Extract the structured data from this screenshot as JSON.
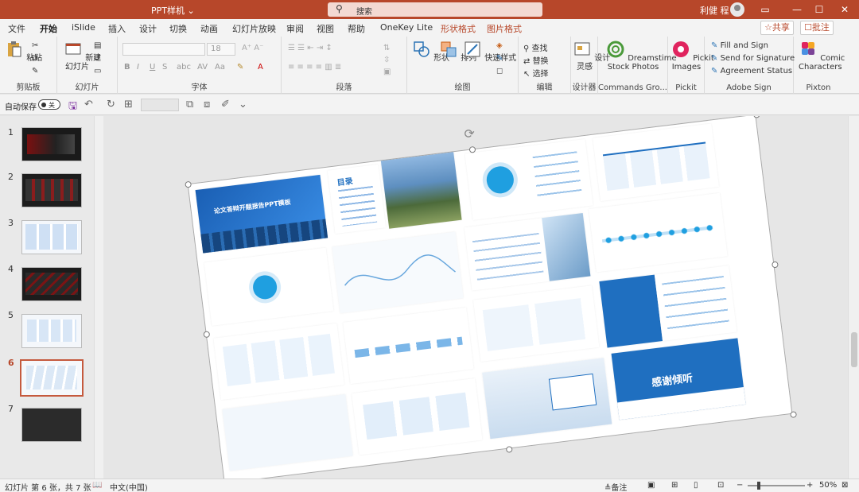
{
  "titlebar": {
    "doc_title": "PPT样机 ⌄",
    "search_placeholder": "搜索",
    "user_name": "利健 程",
    "window_buttons": [
      "▭",
      "—",
      "☐",
      "✕"
    ]
  },
  "tabs": {
    "items": [
      {
        "label": "文件",
        "state": "normal"
      },
      {
        "label": "开始",
        "state": "active"
      },
      {
        "label": "iSlide",
        "state": "normal"
      },
      {
        "label": "插入",
        "state": "normal"
      },
      {
        "label": "设计",
        "state": "normal"
      },
      {
        "label": "切换",
        "state": "normal"
      },
      {
        "label": "动画",
        "state": "normal"
      },
      {
        "label": "幻灯片放映",
        "state": "normal"
      },
      {
        "label": "审阅",
        "state": "normal"
      },
      {
        "label": "视图",
        "state": "normal"
      },
      {
        "label": "帮助",
        "state": "normal"
      },
      {
        "label": "OneKey Lite",
        "state": "normal"
      },
      {
        "label": "形状格式",
        "state": "contextual"
      },
      {
        "label": "图片格式",
        "state": "contextual"
      }
    ],
    "share_label": "☆共享",
    "comments_label": "☐批注"
  },
  "ribbon": {
    "clipboard": {
      "paste_label": "粘贴",
      "group_label": "剪贴板"
    },
    "slides": {
      "new_slide_label": "新建\n幻灯片",
      "group_label": "幻灯片"
    },
    "font": {
      "size_value": "18",
      "bold": "B",
      "italic": "I",
      "underline": "U",
      "strike": "S",
      "group_label": "字体"
    },
    "paragraph": {
      "group_label": "段落"
    },
    "drawing": {
      "shape_label": "形状",
      "arrange_label": "排列",
      "quick_styles_label": "快速样式",
      "group_label": "绘图"
    },
    "editing": {
      "find_label": "查找",
      "replace_label": "替换",
      "select_label": "选择",
      "group_label": "编辑"
    },
    "designer": {
      "label": "设计\n灵感",
      "group_label": "设计器"
    },
    "dreamstime": {
      "label": "Dreamstime\nStock Photos",
      "group_label": "Commands Gro..."
    },
    "pickit": {
      "label": "Pickit\nImages",
      "group_label": "Pickit"
    },
    "adobe_sign": {
      "fill_sign": "Fill and Sign",
      "send_sign": "Send for Signature",
      "agreement": "Agreement Status",
      "group_label": "Adobe Sign"
    },
    "pixton": {
      "label": "Comic\nCharacters",
      "group_label": "Pixton"
    }
  },
  "qat": {
    "autosave_label": "自动保存",
    "toggle_label": "关"
  },
  "thumbnails": {
    "items": [
      {
        "num": "1"
      },
      {
        "num": "2"
      },
      {
        "num": "3"
      },
      {
        "num": "4"
      },
      {
        "num": "5"
      },
      {
        "num": "6",
        "active": true
      },
      {
        "num": "7"
      }
    ]
  },
  "slide": {
    "cover_title": "论文答辩开题报告PPT模板",
    "toc_title": "目录",
    "thanks_title": "感谢倾听"
  },
  "status": {
    "slide_info": "幻灯片 第 6 张，共 7 张",
    "language": "中文(中国)",
    "notes_label": "≜备注",
    "zoom": "50%"
  },
  "colors": {
    "accent": "#b7472a",
    "theme_blue": "#1f6fc0"
  }
}
